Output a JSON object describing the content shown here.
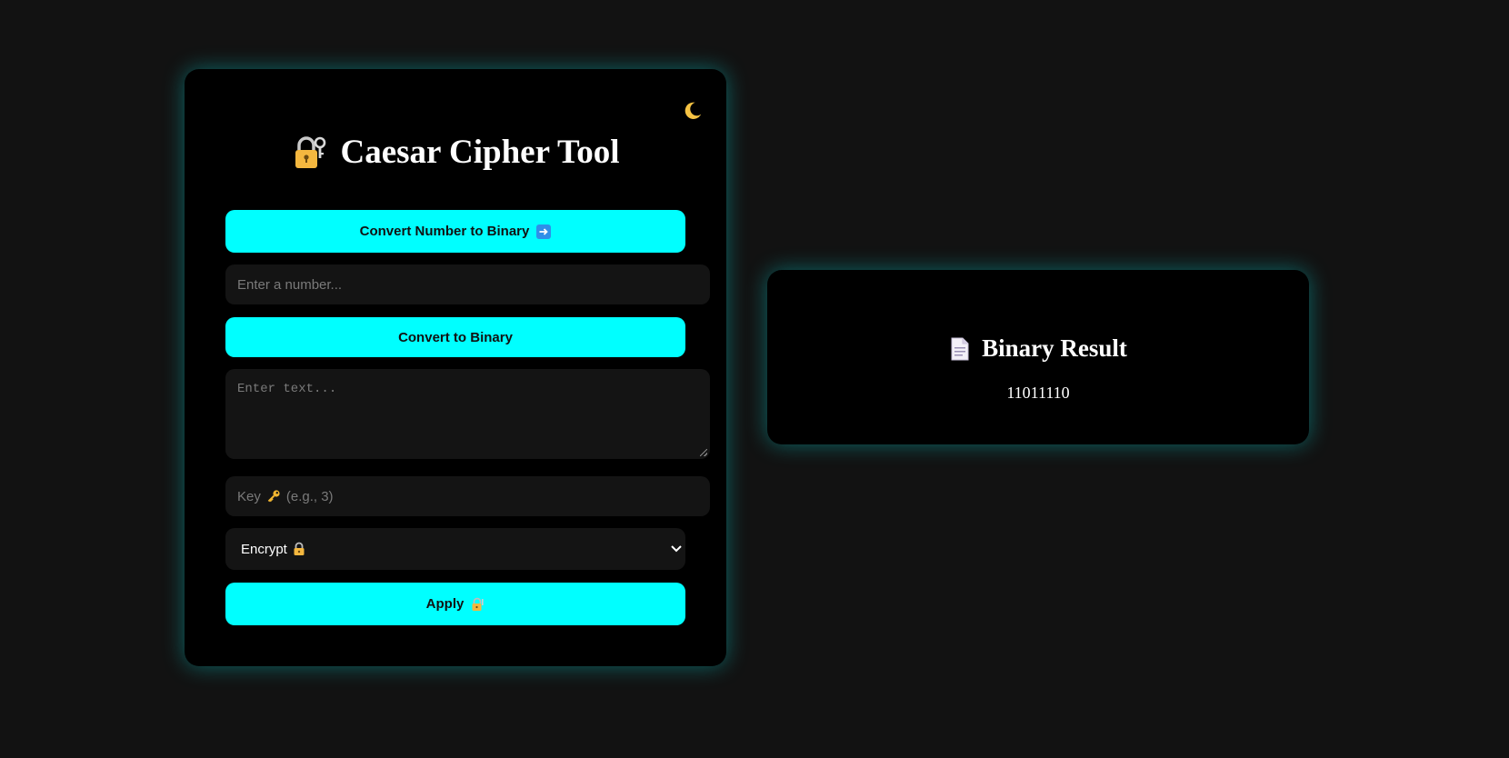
{
  "theme_toggle": {
    "icon": "crescent-moon-icon"
  },
  "main": {
    "title": "Caesar Cipher Tool",
    "title_icon": "locked-with-key-icon",
    "convert_number_button": {
      "label": "Convert Number to Binary",
      "icon": "right-arrow-icon"
    },
    "number_input": {
      "placeholder": "Enter a number...",
      "value": ""
    },
    "convert_binary_button": {
      "label": "Convert to Binary"
    },
    "text_input": {
      "placeholder": "Enter text...",
      "value": ""
    },
    "key_input": {
      "placeholder_before": "Key",
      "placeholder_after": "(e.g., 3)",
      "icon": "key-icon",
      "value": ""
    },
    "mode_select": {
      "selected": "Encrypt",
      "icon": "lock-icon"
    },
    "apply_button": {
      "label": "Apply",
      "icon": "locked-with-key-icon"
    }
  },
  "result": {
    "title": "Binary Result",
    "title_icon": "page-icon",
    "value": "11011110"
  },
  "colors": {
    "background": "#121212",
    "card": "#000000",
    "accent": "#00ffff",
    "field": "#141414"
  }
}
